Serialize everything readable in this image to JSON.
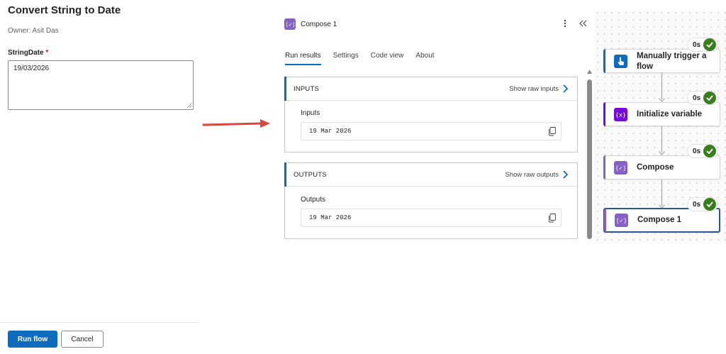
{
  "run_panel": {
    "title": "Convert String to Date",
    "owner": "Owner: Asit Das",
    "field_label": "StringDate",
    "required_marker": "*",
    "field_value": "19/03/2026",
    "run_button": "Run flow",
    "cancel_button": "Cancel"
  },
  "detail_panel": {
    "title": "Compose 1",
    "tabs": [
      {
        "label": "Run results",
        "active": true
      },
      {
        "label": "Settings",
        "active": false
      },
      {
        "label": "Code view",
        "active": false
      },
      {
        "label": "About",
        "active": false
      }
    ],
    "inputs": {
      "header": "INPUTS",
      "raw_link": "Show raw inputs",
      "label": "Inputs",
      "value": "19 Mar 2026"
    },
    "outputs": {
      "header": "OUTPUTS",
      "raw_link": "Show raw outputs",
      "label": "Outputs",
      "value": "19 Mar 2026"
    }
  },
  "flow": {
    "nodes": [
      {
        "label": "Manually trigger a flow",
        "duration": "0s",
        "icon": "manual-trigger-icon",
        "color": "#0f6cbd"
      },
      {
        "label": "Initialize variable",
        "duration": "0s",
        "icon": "variable-icon",
        "color": "#770bd6"
      },
      {
        "label": "Compose",
        "duration": "0s",
        "icon": "compose-icon",
        "color": "#8661c5"
      },
      {
        "label": "Compose 1",
        "duration": "0s",
        "icon": "compose-icon",
        "color": "#8661c5",
        "selected": true
      }
    ]
  },
  "colors": {
    "primary": "#0f6cbd",
    "success": "#3a7d1f",
    "annotation_arrow": "#d9473d"
  }
}
